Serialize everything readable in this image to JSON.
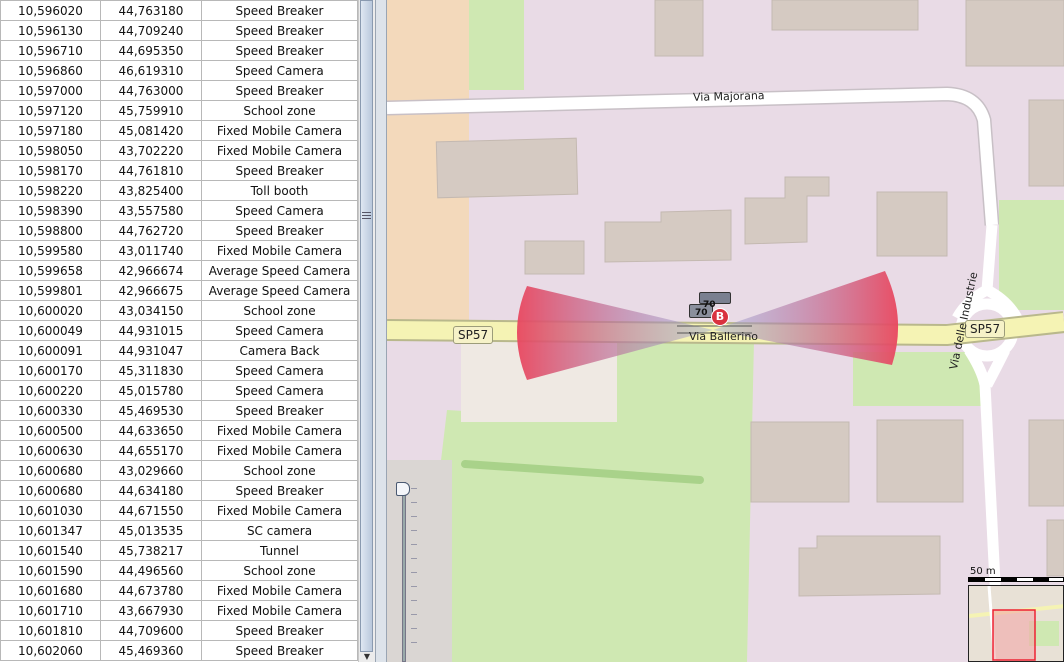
{
  "table": {
    "rows": [
      [
        "10,596020",
        "44,763180",
        "Speed Breaker"
      ],
      [
        "10,596130",
        "44,709240",
        "Speed Breaker"
      ],
      [
        "10,596710",
        "44,695350",
        "Speed Breaker"
      ],
      [
        "10,596860",
        "46,619310",
        "Speed Camera"
      ],
      [
        "10,597000",
        "44,763000",
        "Speed Breaker"
      ],
      [
        "10,597120",
        "45,759910",
        "School zone"
      ],
      [
        "10,597180",
        "45,081420",
        "Fixed Mobile Camera"
      ],
      [
        "10,598050",
        "43,702220",
        "Fixed Mobile Camera"
      ],
      [
        "10,598170",
        "44,761810",
        "Speed Breaker"
      ],
      [
        "10,598220",
        "43,825400",
        "Toll booth"
      ],
      [
        "10,598390",
        "43,557580",
        "Speed Camera"
      ],
      [
        "10,598800",
        "44,762720",
        "Speed Breaker"
      ],
      [
        "10,599580",
        "43,011740",
        "Fixed Mobile Camera"
      ],
      [
        "10,599658",
        "42,966674",
        "Average Speed Camera"
      ],
      [
        "10,599801",
        "42,966675",
        "Average Speed Camera"
      ],
      [
        "10,600020",
        "43,034150",
        "School zone"
      ],
      [
        "10,600049",
        "44,931015",
        "Speed Camera"
      ],
      [
        "10,600091",
        "44,931047",
        "Camera Back"
      ],
      [
        "10,600170",
        "45,311830",
        "Speed Camera"
      ],
      [
        "10,600220",
        "45,015780",
        "Speed Camera"
      ],
      [
        "10,600330",
        "45,469530",
        "Speed Breaker"
      ],
      [
        "10,600500",
        "44,633650",
        "Fixed Mobile Camera"
      ],
      [
        "10,600630",
        "44,655170",
        "Fixed Mobile Camera"
      ],
      [
        "10,600680",
        "43,029660",
        "School zone"
      ],
      [
        "10,600680",
        "44,634180",
        "Speed Breaker"
      ],
      [
        "10,601030",
        "44,671550",
        "Fixed Mobile Camera"
      ],
      [
        "10,601347",
        "45,013535",
        "SC camera"
      ],
      [
        "10,601540",
        "45,738217",
        "Tunnel"
      ],
      [
        "10,601590",
        "44,496560",
        "School zone"
      ],
      [
        "10,601680",
        "44,673780",
        "Fixed Mobile Camera"
      ],
      [
        "10,601710",
        "43,667930",
        "Fixed Mobile Camera"
      ],
      [
        "10,601810",
        "44,709600",
        "Speed Breaker"
      ],
      [
        "10,602060",
        "45,469360",
        "Speed Breaker"
      ]
    ]
  },
  "map": {
    "labels": {
      "via_majorana": "Via Majorana",
      "sp57_left": "SP57",
      "sp57_right": "SP57",
      "via_delle_industrie": "Via delle Industrie",
      "via_ballerino": "Via Ballerino",
      "scale": "50 m"
    },
    "marker_badges": [
      "70",
      "70"
    ],
    "icons": {
      "camera_cluster": "speed-camera-cluster-icon",
      "marker": "red-b-marker-icon",
      "zoom": "zoom-slider-knob"
    },
    "colors": {
      "land": "#e9dbe6",
      "green": "#cfe8b2",
      "building": "#d5cac2",
      "road_primary": "#f5f3b4",
      "cone_edge": "#e9475f",
      "cone_center": "#8fa0d8"
    }
  }
}
